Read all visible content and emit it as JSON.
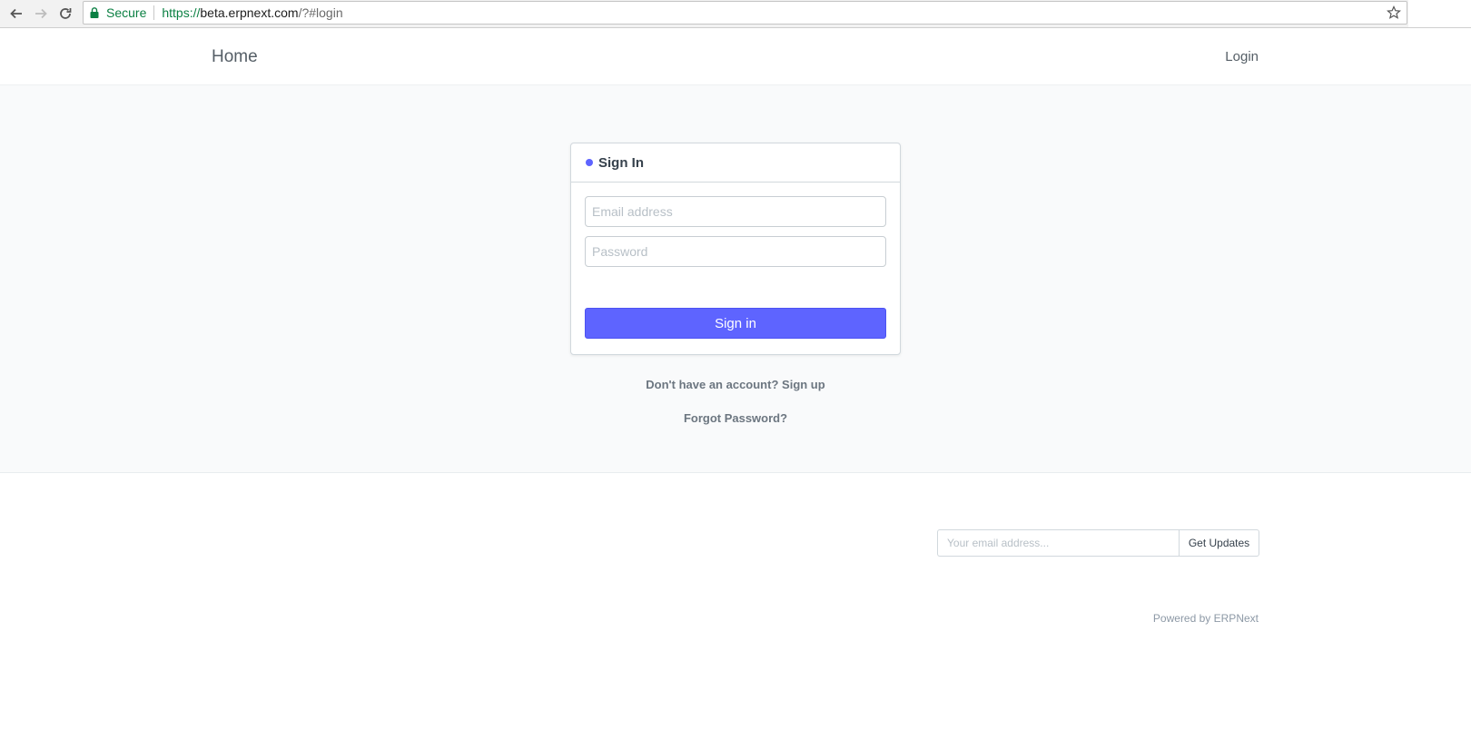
{
  "browser": {
    "secure_label": "Secure",
    "url_scheme": "https://",
    "url_host": "beta.erpnext.com",
    "url_path": "/?#login"
  },
  "nav": {
    "brand": "Home",
    "login_link": "Login"
  },
  "login": {
    "title": "Sign In",
    "email_placeholder": "Email address",
    "password_placeholder": "Password",
    "signin_button": "Sign in",
    "signup_prompt": "Don't have an account?",
    "signup_link": "Sign up",
    "forgot_password": "Forgot Password?"
  },
  "footer": {
    "subscribe_placeholder": "Your email address...",
    "subscribe_button": "Get Updates",
    "powered_by_prefix": "Powered by",
    "powered_by_link": "ERPNext"
  },
  "colors": {
    "primary": "#5e64ff",
    "secure_green": "#0b8043",
    "page_background": "#f9fafb"
  }
}
